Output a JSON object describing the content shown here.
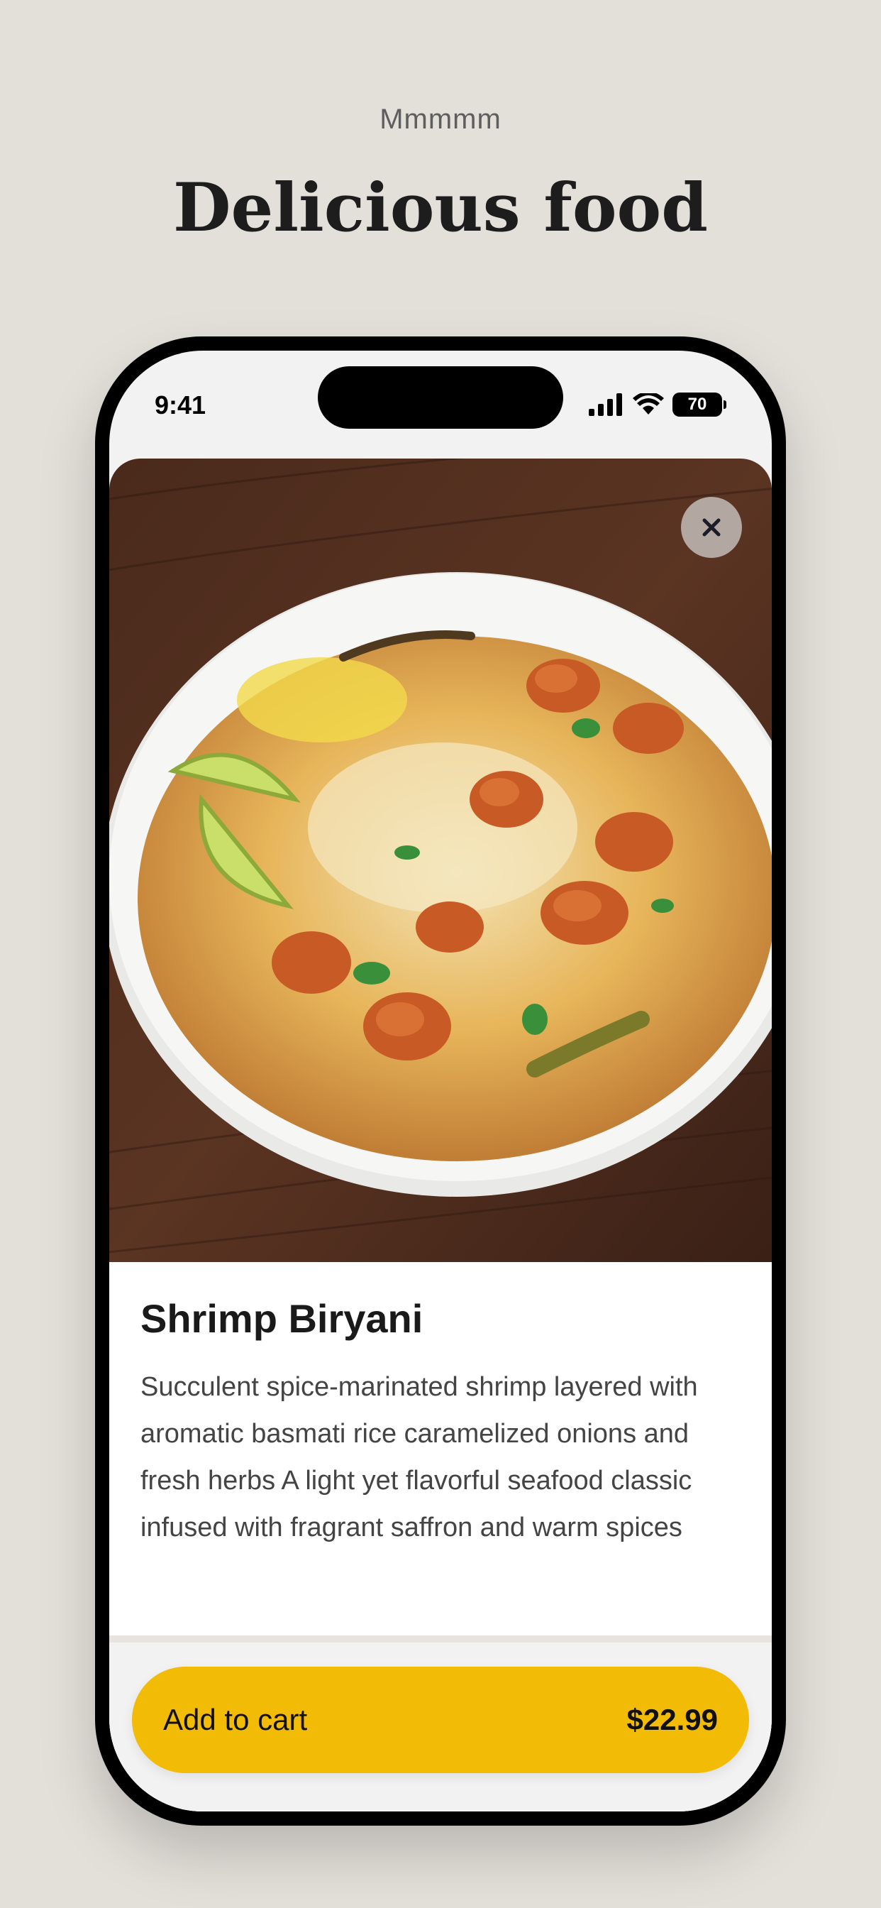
{
  "header": {
    "eyebrow": "Mmmmm",
    "title": "Delicious food"
  },
  "status_bar": {
    "time": "9:41",
    "battery": "70",
    "icons": [
      "signal-icon",
      "wifi-icon",
      "battery-icon"
    ]
  },
  "product": {
    "image_icon": "shrimp-biryani-photo",
    "close_icon": "close-icon",
    "name": "Shrimp Biryani",
    "description": "Succulent spice-marinated shrimp layered with aromatic basmati rice caramelized onions and fresh herbs A light yet flavorful seafood classic infused with fragrant saffron and warm spices"
  },
  "cart": {
    "label": "Add to cart",
    "price": "$22.99"
  },
  "colors": {
    "background": "#e3e0da",
    "accent": "#f2bb05",
    "text": "#1a1a1a"
  }
}
